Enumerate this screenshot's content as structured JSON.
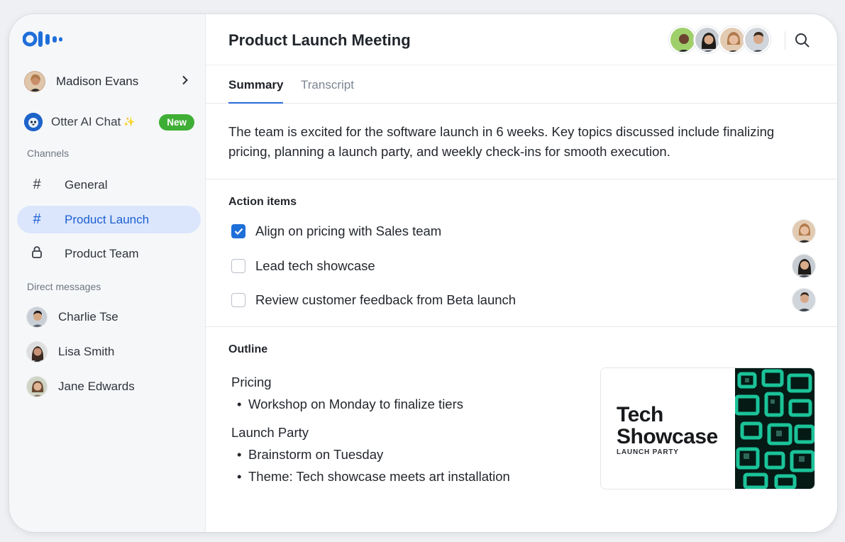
{
  "sidebar": {
    "profile": {
      "name": "Madison Evans"
    },
    "otter_chat": {
      "label": "Otter AI Chat",
      "sparkle": "✨",
      "badge": "New"
    },
    "channels_label": "Channels",
    "channels": [
      {
        "label": "General",
        "icon": "hash-icon",
        "active": false
      },
      {
        "label": "Product Launch",
        "icon": "hash-icon",
        "active": true
      },
      {
        "label": "Product Team",
        "icon": "lock-icon",
        "active": false
      }
    ],
    "dm_label": "Direct messages",
    "direct_messages": [
      {
        "name": "Charlie Tse"
      },
      {
        "name": "Lisa Smith"
      },
      {
        "name": "Jane Edwards"
      }
    ]
  },
  "header": {
    "title": "Product Launch Meeting"
  },
  "tabs": [
    {
      "label": "Summary",
      "active": true
    },
    {
      "label": "Transcript",
      "active": false
    }
  ],
  "summary": "The team is excited for the software launch in 6 weeks. Key topics discussed include finalizing pricing, planning a launch party, and weekly check-ins for smooth execution.",
  "action_items": {
    "title": "Action items",
    "items": [
      {
        "label": "Align on pricing with Sales team",
        "checked": true
      },
      {
        "label": "Lead tech showcase",
        "checked": false
      },
      {
        "label": "Review customer feedback from Beta launch",
        "checked": false
      }
    ]
  },
  "outline": {
    "title": "Outline",
    "sections": [
      {
        "heading": "Pricing",
        "bullets": [
          "Workshop on Monday to finalize tiers"
        ]
      },
      {
        "heading": "Launch Party",
        "bullets": [
          "Brainstorm on Tuesday",
          "Theme: Tech showcase meets art installation"
        ]
      }
    ],
    "bullet_char": "•"
  },
  "launch_card": {
    "title_line1": "Tech",
    "title_line2": "Showcase",
    "subtitle": "LAUNCH PARTY"
  },
  "colors": {
    "accent": "#1f6fd9",
    "active_nav_bg": "#dbe6fc",
    "new_badge": "#3fae35",
    "card_art": "#16c9a0"
  }
}
